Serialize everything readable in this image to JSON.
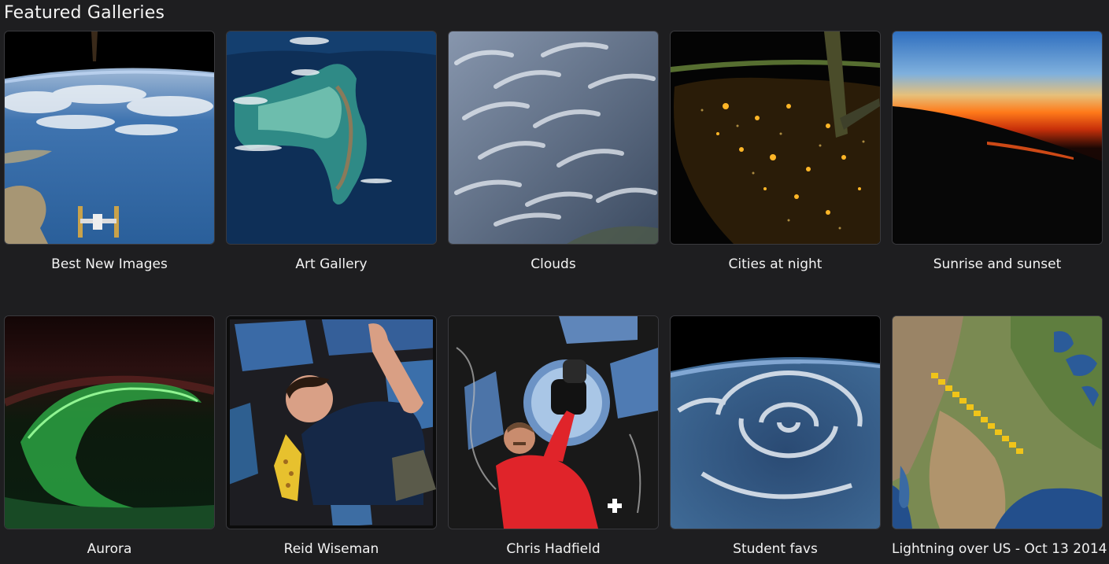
{
  "page_title": "Featured Galleries",
  "galleries": [
    {
      "label": "Best New Images",
      "icon": "earth-with-space-station-image"
    },
    {
      "label": "Art Gallery",
      "icon": "island-from-orbit-image"
    },
    {
      "label": "Clouds",
      "icon": "clouds-image"
    },
    {
      "label": "Cities at night",
      "icon": "city-lights-at-night-image"
    },
    {
      "label": "Sunrise and sunset",
      "icon": "orbital-sunset-image"
    },
    {
      "label": "Aurora",
      "icon": "aurora-image"
    },
    {
      "label": "Reid Wiseman",
      "icon": "astronaut-portrait-image"
    },
    {
      "label": "Chris Hadfield",
      "icon": "astronaut-with-camera-image"
    },
    {
      "label": "Student favs",
      "icon": "hurricane-image"
    },
    {
      "label": "Lightning over US - Oct 13 2014",
      "icon": "lightning-map-image"
    }
  ],
  "colors": {
    "background": "#1e1e20",
    "text": "#f2f2f2",
    "tile_border": "#3a3a3e"
  }
}
